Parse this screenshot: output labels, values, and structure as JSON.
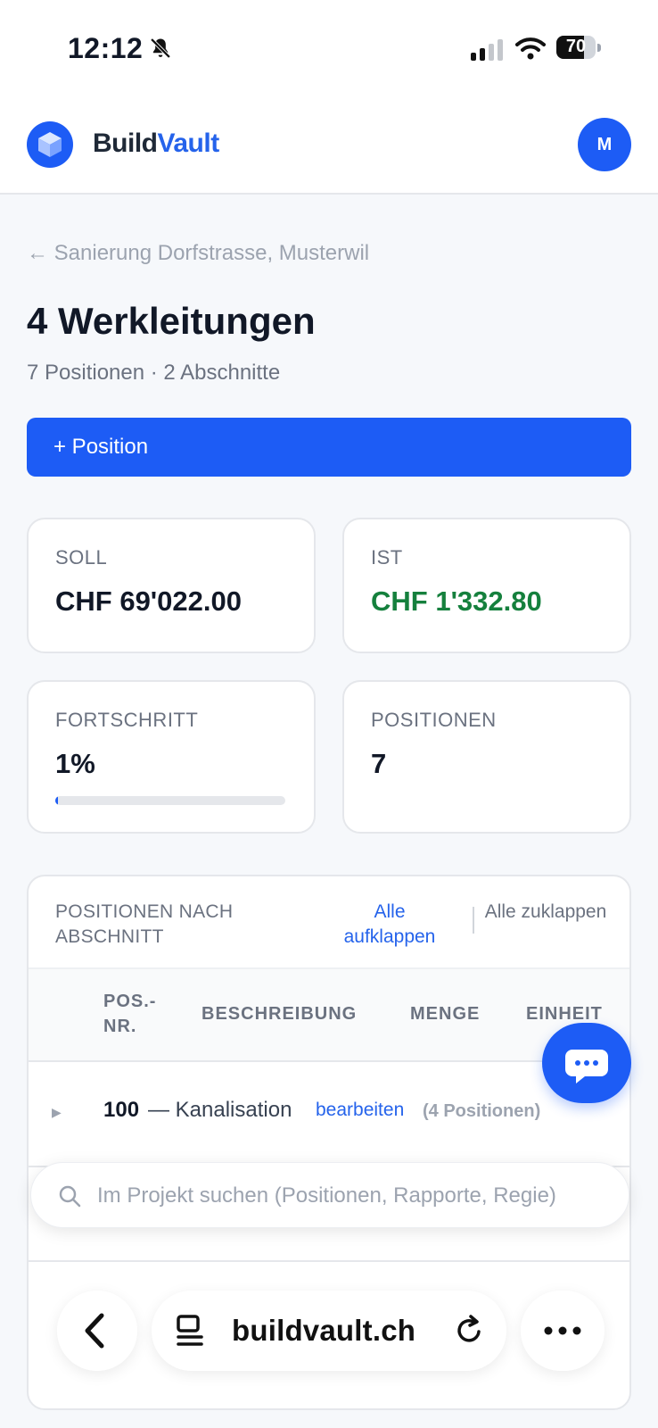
{
  "status_bar": {
    "time": "12:12",
    "battery": "70",
    "battery_level": 0.7
  },
  "header": {
    "brand_part1": "Build",
    "brand_part2": "Vault",
    "avatar_initial": "M"
  },
  "breadcrumb": "← Sanierung Dorfstrasse, Musterwil",
  "page": {
    "title": "4 Werkleitungen",
    "subtitle": "7 Positionen · 2 Abschnitte"
  },
  "add_button": "+ Position",
  "stats": {
    "soll": {
      "label": "SOLL",
      "value": "CHF 69'022.00"
    },
    "ist": {
      "label": "IST",
      "value": "CHF 1'332.80"
    },
    "progress": {
      "label": "FORTSCHRITT",
      "value": "1%",
      "fraction": 0.01
    },
    "positions": {
      "label": "POSITIONEN",
      "value": "7"
    }
  },
  "table": {
    "title": "POSITIONEN NACH ABSCHNITT",
    "expand_all": "Alle aufklappen",
    "collapse_all": "Alle zuklappen",
    "columns": [
      "POS.-NR.",
      "BESCHREIBUNG",
      "MENGE",
      "EINHEIT"
    ],
    "sections": [
      {
        "number": "100",
        "name": "— Kanalisation",
        "edit": "bearbeiten",
        "count": "(4 Positionen)"
      }
    ]
  },
  "search": {
    "placeholder": "Im Projekt suchen (Positionen, Rapporte, Regie)"
  },
  "browser": {
    "url": "buildvault.ch"
  },
  "colors": {
    "primary": "#1d5cf5",
    "positive": "#15803d"
  }
}
